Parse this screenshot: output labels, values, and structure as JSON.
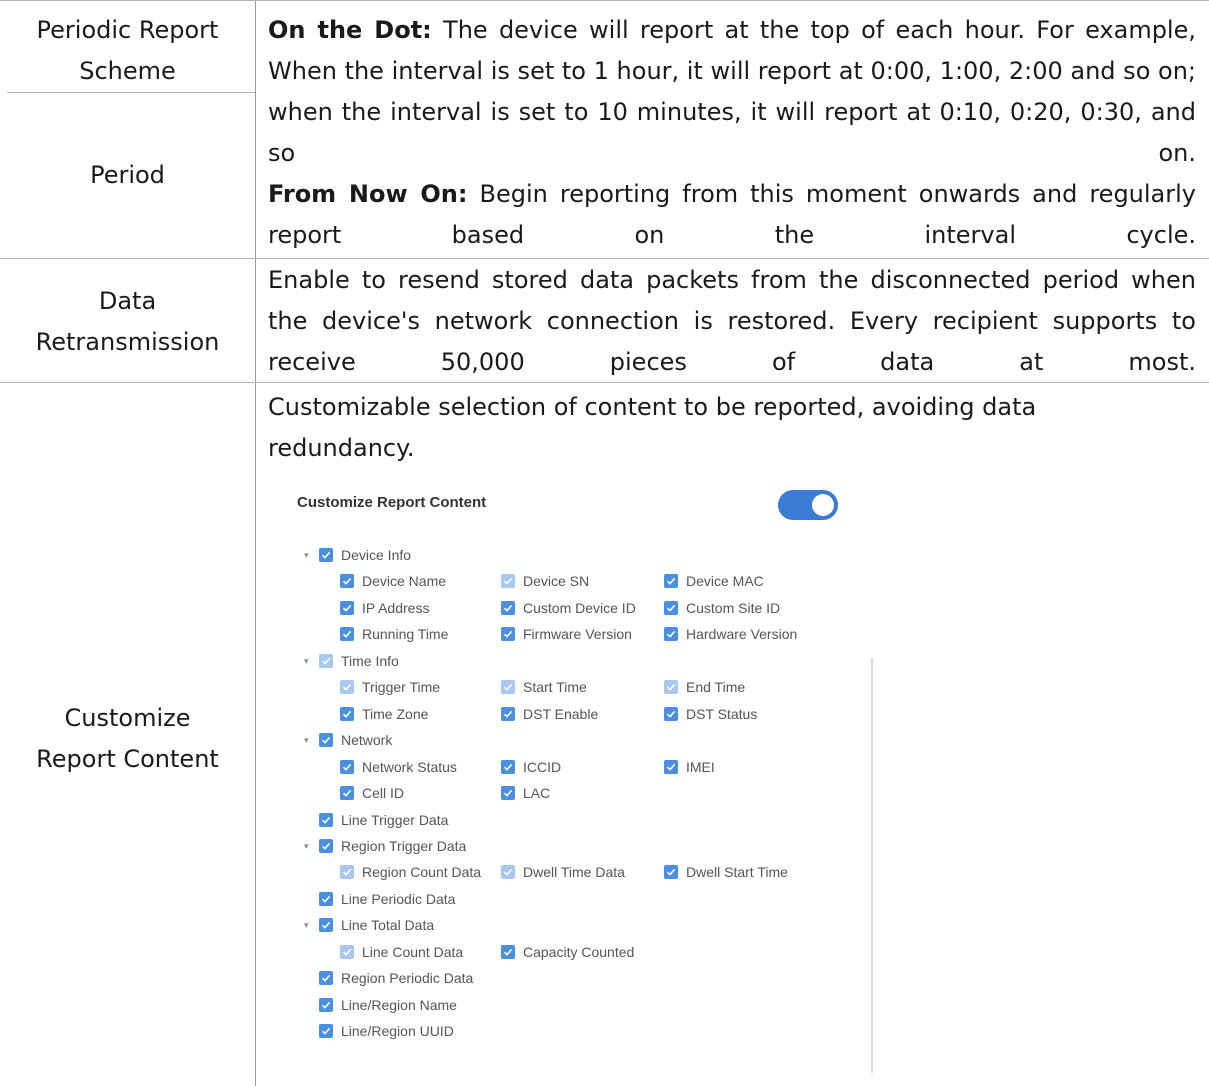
{
  "rows": [
    {
      "label_lines": [
        "Periodic Report",
        "Scheme"
      ]
    },
    {
      "label_lines": [
        "Period"
      ]
    },
    {
      "label_lines": [
        "Data",
        "Retransmission"
      ],
      "desc_lines": [
        "Enable to resend stored data packets from the disconnected period when",
        "the device's network connection is restored. Every recipient supports to",
        "receive 50,000 pieces of data at most."
      ]
    },
    {
      "label_lines": [
        "Customize",
        "Report Content"
      ],
      "desc_lines": [
        "Customizable selection of content to be reported, avoiding data",
        "redundancy."
      ]
    }
  ],
  "scheme_desc": {
    "on_the_dot_term": "On the Dot:",
    "on_the_dot_line1": " The device will report at the top of each hour. For example,",
    "on_the_dot_line2": "When the interval is set to 1 hour, it will report at 0:00, 1:00, 2:00 and so on;",
    "on_the_dot_line3": "when the interval is set to 10 minutes, it will report at 0:10, 0:20, 0:30, and",
    "on_the_dot_line4": "so on.",
    "from_now_term": "From Now On:",
    "from_now_line1": " Begin reporting from this moment onwards and regularly",
    "from_now_line2": "report based on the interval cycle."
  },
  "panel": {
    "title": "Customize Report Content",
    "toggle_on": true,
    "accent": "#4a8fe0",
    "tree": [
      {
        "label": "Device Info",
        "state": "on",
        "expander": true,
        "level": 0,
        "col": 0
      },
      {
        "label": "Device Name",
        "state": "on",
        "level": 1,
        "col": 0
      },
      {
        "label": "Device SN",
        "state": "half",
        "level": 1,
        "col": 1
      },
      {
        "label": "Device MAC",
        "state": "on",
        "level": 1,
        "col": 2
      },
      {
        "label": "IP Address",
        "state": "on",
        "level": 1,
        "col": 0
      },
      {
        "label": "Custom Device ID",
        "state": "on",
        "level": 1,
        "col": 1
      },
      {
        "label": "Custom Site ID",
        "state": "on",
        "level": 1,
        "col": 2
      },
      {
        "label": "Running Time",
        "state": "on",
        "level": 1,
        "col": 0
      },
      {
        "label": "Firmware Version",
        "state": "on",
        "level": 1,
        "col": 1
      },
      {
        "label": "Hardware Version",
        "state": "on",
        "level": 1,
        "col": 2
      },
      {
        "label": "Time Info",
        "state": "half",
        "expander": true,
        "level": 0,
        "col": 0
      },
      {
        "label": "Trigger Time",
        "state": "half",
        "level": 1,
        "col": 0
      },
      {
        "label": "Start Time",
        "state": "half",
        "level": 1,
        "col": 1
      },
      {
        "label": "End Time",
        "state": "half",
        "level": 1,
        "col": 2
      },
      {
        "label": "Time Zone",
        "state": "on",
        "level": 1,
        "col": 0
      },
      {
        "label": "DST Enable",
        "state": "on",
        "level": 1,
        "col": 1
      },
      {
        "label": "DST Status",
        "state": "on",
        "level": 1,
        "col": 2
      },
      {
        "label": "Network",
        "state": "on",
        "expander": true,
        "level": 0,
        "col": 0
      },
      {
        "label": "Network Status",
        "state": "on",
        "level": 1,
        "col": 0
      },
      {
        "label": "ICCID",
        "state": "on",
        "level": 1,
        "col": 1
      },
      {
        "label": "IMEI",
        "state": "on",
        "level": 1,
        "col": 2
      },
      {
        "label": "Cell ID",
        "state": "on",
        "level": 1,
        "col": 0
      },
      {
        "label": "LAC",
        "state": "on",
        "level": 1,
        "col": 1
      },
      {
        "label": "Line Trigger Data",
        "state": "on",
        "level": 0,
        "col": 0
      },
      {
        "label": "Region Trigger Data",
        "state": "on",
        "expander": true,
        "level": 0,
        "col": 0
      },
      {
        "label": "Region Count Data",
        "state": "half",
        "level": 1,
        "col": 0
      },
      {
        "label": "Dwell Time Data",
        "state": "half",
        "level": 1,
        "col": 1
      },
      {
        "label": "Dwell Start Time",
        "state": "on",
        "level": 1,
        "col": 2
      },
      {
        "label": "Line Periodic Data",
        "state": "on",
        "level": 0,
        "col": 0
      },
      {
        "label": "Line Total Data",
        "state": "on",
        "expander": true,
        "level": 0,
        "col": 0
      },
      {
        "label": "Line Count Data",
        "state": "half",
        "level": 1,
        "col": 0
      },
      {
        "label": "Capacity Counted",
        "state": "on",
        "level": 1,
        "col": 1
      },
      {
        "label": "Region Periodic Data",
        "state": "on",
        "level": 0,
        "col": 0
      },
      {
        "label": "Line/Region Name",
        "state": "on",
        "level": 0,
        "col": 0
      },
      {
        "label": "Line/Region UUID",
        "state": "on",
        "level": 0,
        "col": 0
      }
    ]
  }
}
